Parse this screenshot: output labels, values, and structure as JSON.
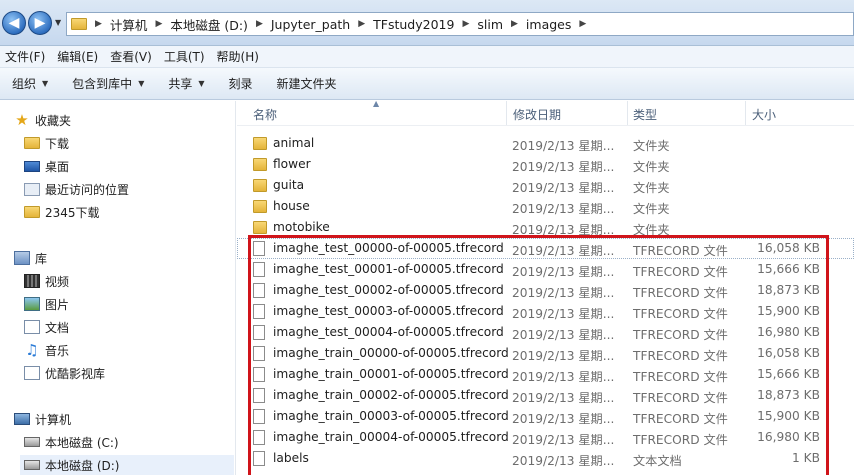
{
  "address": {
    "crumbs": [
      "计算机",
      "本地磁盘 (D:)",
      "Jupyter_path",
      "TFstudy2019",
      "slim",
      "images"
    ]
  },
  "menu": [
    "文件(F)",
    "编辑(E)",
    "查看(V)",
    "工具(T)",
    "帮助(H)"
  ],
  "toolbar": {
    "organize": "组织",
    "include_library": "包含到库中",
    "share": "共享",
    "burn": "刻录",
    "new_folder": "新建文件夹"
  },
  "nav": {
    "favorites": "收藏夹",
    "downloads": "下载",
    "desktop": "桌面",
    "recent": "最近访问的位置",
    "downloads_2345": "2345下载",
    "libraries": "库",
    "videos": "视频",
    "pictures": "图片",
    "documents": "文档",
    "music": "音乐",
    "youku": "优酷影视库",
    "computer": "计算机",
    "drive_c": "本地磁盘 (C:)",
    "drive_d": "本地磁盘 (D:)"
  },
  "columns": {
    "name": "名称",
    "modified": "修改日期",
    "type": "类型",
    "size": "大小"
  },
  "files": [
    {
      "name": "animal",
      "date": "2019/2/13 星期...",
      "type": "文件夹",
      "size": "",
      "kind": "folder"
    },
    {
      "name": "flower",
      "date": "2019/2/13 星期...",
      "type": "文件夹",
      "size": "",
      "kind": "folder"
    },
    {
      "name": "guita",
      "date": "2019/2/13 星期...",
      "type": "文件夹",
      "size": "",
      "kind": "folder"
    },
    {
      "name": "house",
      "date": "2019/2/13 星期...",
      "type": "文件夹",
      "size": "",
      "kind": "folder"
    },
    {
      "name": "motobike",
      "date": "2019/2/13 星期...",
      "type": "文件夹",
      "size": "",
      "kind": "folder"
    },
    {
      "name": "imaghe_test_00000-of-00005.tfrecord",
      "date": "2019/2/13 星期...",
      "type": "TFRECORD 文件",
      "size": "16,058 KB",
      "kind": "file"
    },
    {
      "name": "imaghe_test_00001-of-00005.tfrecord",
      "date": "2019/2/13 星期...",
      "type": "TFRECORD 文件",
      "size": "15,666 KB",
      "kind": "file"
    },
    {
      "name": "imaghe_test_00002-of-00005.tfrecord",
      "date": "2019/2/13 星期...",
      "type": "TFRECORD 文件",
      "size": "18,873 KB",
      "kind": "file"
    },
    {
      "name": "imaghe_test_00003-of-00005.tfrecord",
      "date": "2019/2/13 星期...",
      "type": "TFRECORD 文件",
      "size": "15,900 KB",
      "kind": "file"
    },
    {
      "name": "imaghe_test_00004-of-00005.tfrecord",
      "date": "2019/2/13 星期...",
      "type": "TFRECORD 文件",
      "size": "16,980 KB",
      "kind": "file"
    },
    {
      "name": "imaghe_train_00000-of-00005.tfrecord",
      "date": "2019/2/13 星期...",
      "type": "TFRECORD 文件",
      "size": "16,058 KB",
      "kind": "file"
    },
    {
      "name": "imaghe_train_00001-of-00005.tfrecord",
      "date": "2019/2/13 星期...",
      "type": "TFRECORD 文件",
      "size": "15,666 KB",
      "kind": "file"
    },
    {
      "name": "imaghe_train_00002-of-00005.tfrecord",
      "date": "2019/2/13 星期...",
      "type": "TFRECORD 文件",
      "size": "18,873 KB",
      "kind": "file"
    },
    {
      "name": "imaghe_train_00003-of-00005.tfrecord",
      "date": "2019/2/13 星期...",
      "type": "TFRECORD 文件",
      "size": "15,900 KB",
      "kind": "file"
    },
    {
      "name": "imaghe_train_00004-of-00005.tfrecord",
      "date": "2019/2/13 星期...",
      "type": "TFRECORD 文件",
      "size": "16,980 KB",
      "kind": "file"
    },
    {
      "name": "labels",
      "date": "2019/2/13 星期...",
      "type": "文本文档",
      "size": "1 KB",
      "kind": "file"
    }
  ]
}
